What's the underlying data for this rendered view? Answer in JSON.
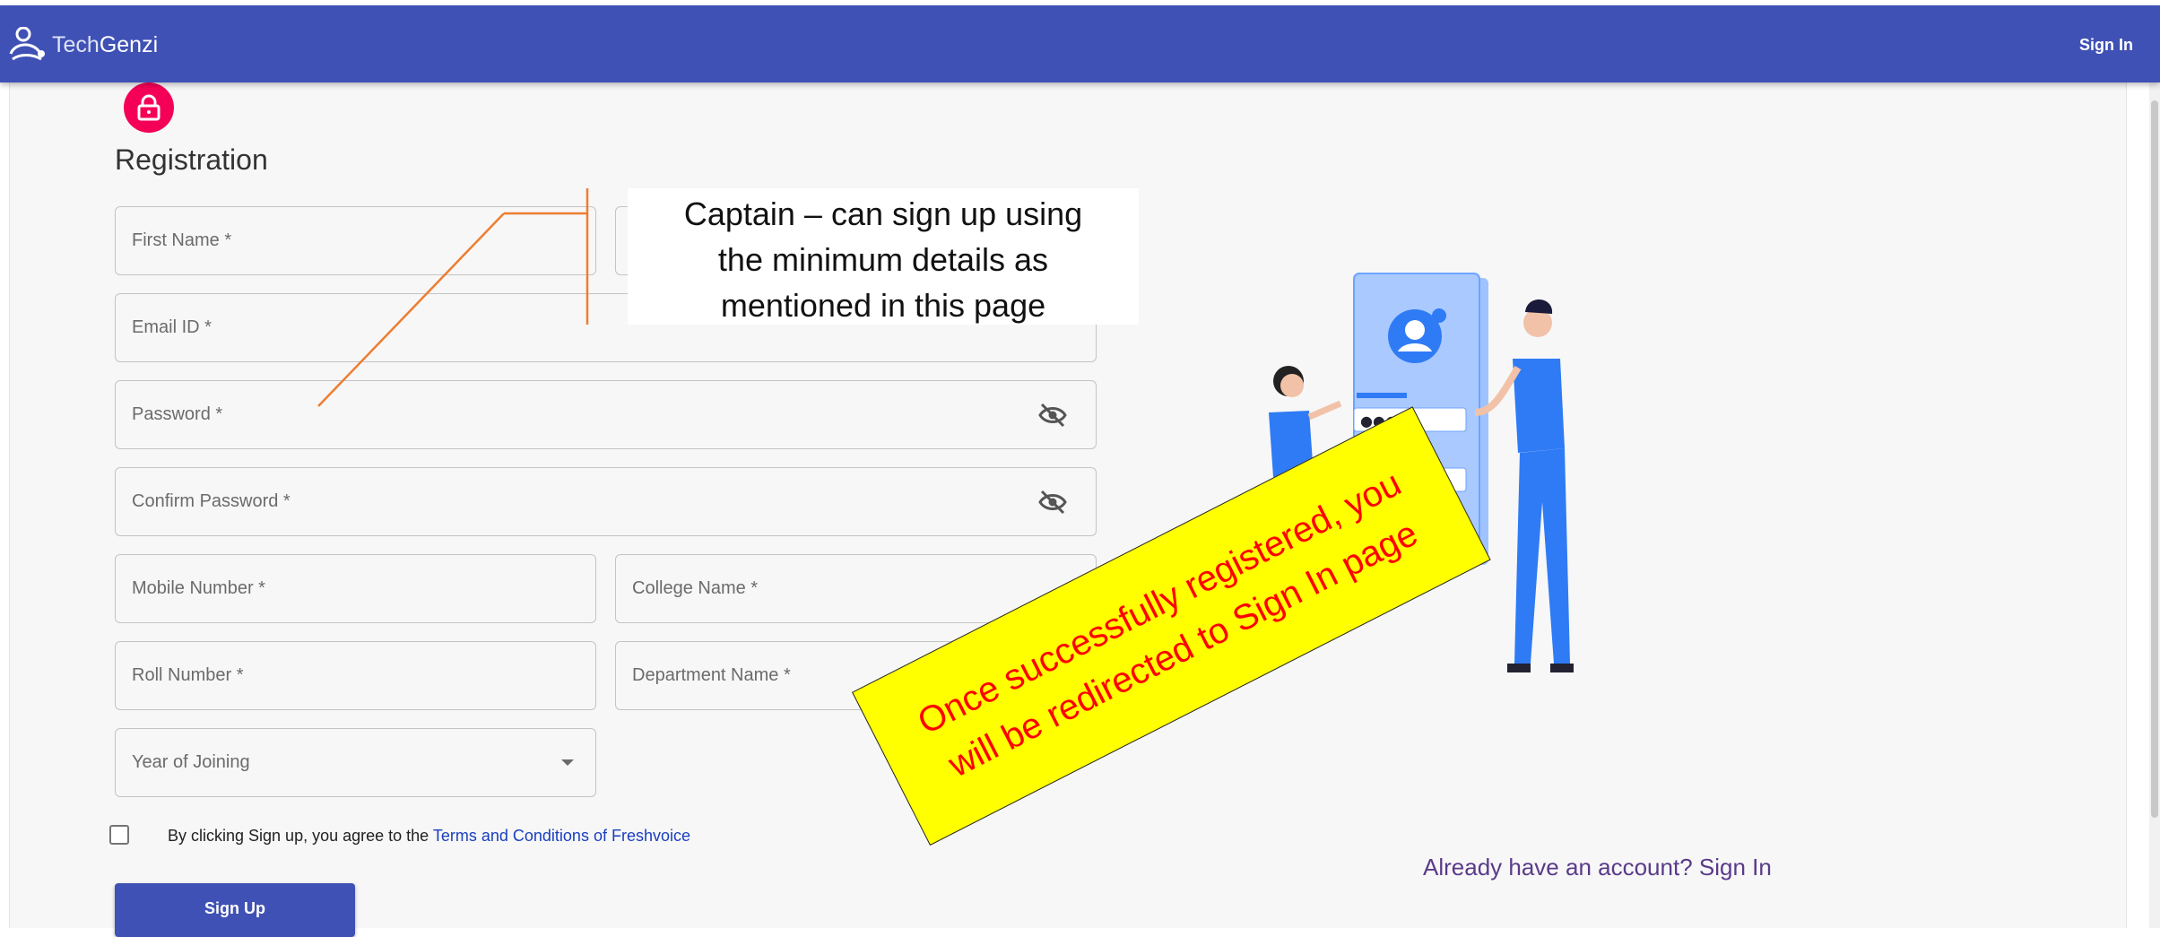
{
  "header": {
    "brand_prefix": "Tech",
    "brand_suffix": "Genzi",
    "signin_label": "Sign In",
    "bar_color": "#3f51b5"
  },
  "form": {
    "title": "Registration",
    "lock_icon": "lock-icon",
    "fields": {
      "first_name": "First Name *",
      "email": "Email ID *",
      "password": "Password *",
      "confirm_password": "Confirm Password *",
      "mobile": "Mobile Number *",
      "college": "College Name *",
      "roll": "Roll Number *",
      "department": "Department Name *",
      "year": "Year of Joining"
    },
    "terms_prefix": "By clicking Sign up, you agree to the ",
    "terms_link": "Terms and Conditions of Freshvoice",
    "signup_label": "Sign Up",
    "already_label": "Already have an account? Sign In",
    "accent_color": "#f50057"
  },
  "annotations": {
    "callout_line1": "Captain – can sign up using",
    "callout_line2": "the minimum details as",
    "callout_line3": "mentioned in this page",
    "note_line1": "Once successfully registered, you",
    "note_line2": "will be redirected to Sign In page",
    "note_color": "#ffff00",
    "note_text_color": "#ff0000"
  },
  "illustration": {
    "dots_short": "●●●",
    "dots_long": "●●●●●"
  }
}
